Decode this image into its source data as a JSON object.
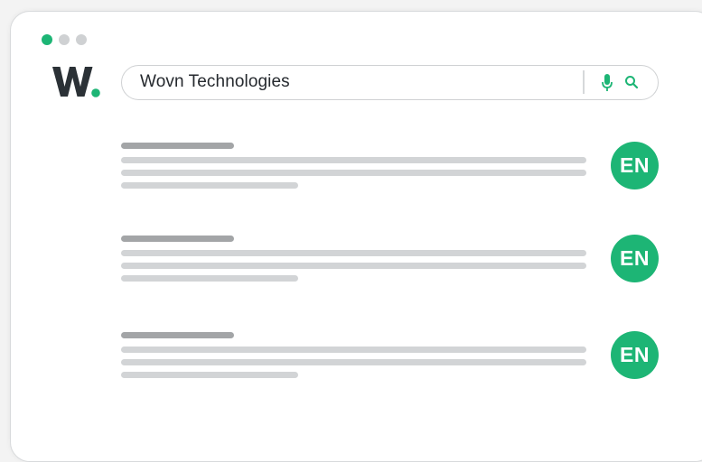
{
  "window": {
    "controls": [
      "active",
      "inactive",
      "inactive"
    ],
    "accent_color": "#1db575"
  },
  "logo": {
    "letter": "W",
    "dot_color": "#1db575"
  },
  "search": {
    "query": "Wovn Technologies",
    "icons": [
      "microphone-icon",
      "search-icon"
    ]
  },
  "results": [
    {
      "language": "EN"
    },
    {
      "language": "EN"
    },
    {
      "language": "EN"
    }
  ]
}
